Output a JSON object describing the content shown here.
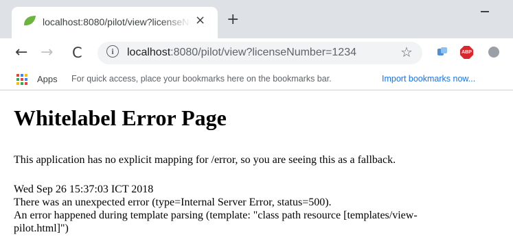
{
  "browser": {
    "tab_title": "localhost:8080/pilot/view?licenseNumber=1234",
    "tab_close_icon": "×",
    "new_tab_icon": "+",
    "back_icon": "←",
    "forward_icon": "→",
    "reload_icon": "C",
    "info_icon": "i",
    "url_host": "localhost",
    "url_rest": ":8080/pilot/view?licenseNumber=1234",
    "star_icon": "☆",
    "abp_label": "ABP"
  },
  "bookmarks": {
    "apps_label": "Apps",
    "hint": "For quick access, place your bookmarks here on the bookmarks bar.",
    "import_link": "Import bookmarks now..."
  },
  "page": {
    "title": "Whitelabel Error Page",
    "fallback": "This application has no explicit mapping for /error, so you are seeing this as a fallback.",
    "timestamp": "Wed Sep 26 15:37:03 ICT 2018",
    "error_line": "There was an unexpected error (type=Internal Server Error, status=500).",
    "detail_line1": "An error happened during template parsing (template: \"class path resource [templates/view-",
    "detail_line2": "pilot.html]\")"
  },
  "colors": {
    "tabstrip": "#dee1e6",
    "link": "#1a73e8",
    "abp": "#d8282e"
  }
}
